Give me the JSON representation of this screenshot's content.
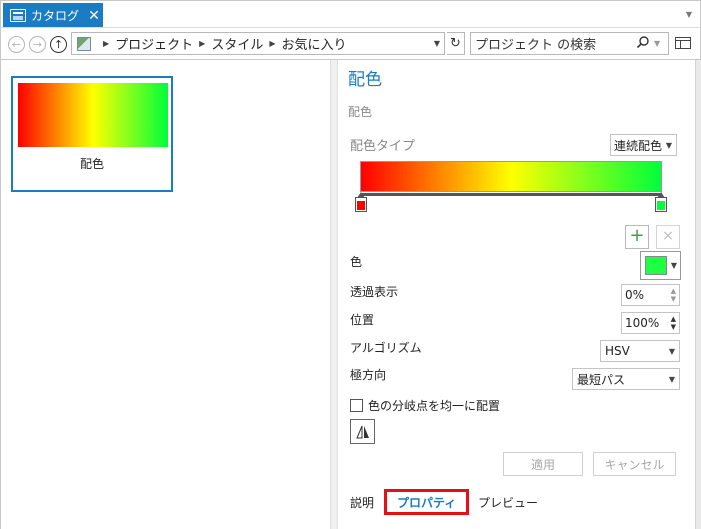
{
  "tab": {
    "title": "カタログ",
    "close": "✕",
    "icon": "catalog-icon"
  },
  "address": {
    "back_icon": "back-arrow-icon",
    "forward_icon": "forward-arrow-icon",
    "up_icon": "up-arrow-icon",
    "path": [
      "プロジェクト",
      "スタイル",
      "お気に入り"
    ],
    "search_placeholder": "プロジェクト の検索"
  },
  "gallery": {
    "items": [
      {
        "label": "配色"
      }
    ]
  },
  "properties": {
    "title": "配色",
    "subtitle": "配色",
    "color_scheme_type_label": "配色タイプ",
    "color_scheme_type_value": "連続配色",
    "ramp_colors": {
      "start": "#ff0000",
      "mid": "#ffff00",
      "end": "#00ff3a"
    },
    "stops": [
      {
        "color": "#ff0000",
        "position_percent": 0
      },
      {
        "color": "#00ff3a",
        "position_percent": 100
      }
    ],
    "add_stop_label": "+",
    "delete_stop_label": "×",
    "color_label": "色",
    "selected_color": "#1eff46",
    "transparency_label": "透過表示",
    "transparency_value": "0%",
    "position_label": "位置",
    "position_value": "100%",
    "algorithm_label": "アルゴリズム",
    "algorithm_value": "HSV",
    "polar_direction_label": "極方向",
    "polar_direction_value": "最短パス",
    "distribute_evenly_label": "色の分岐点を均一に配置",
    "apply_label": "適用",
    "cancel_label": "キャンセル"
  },
  "bottom_tabs": [
    {
      "label": "説明",
      "active": false
    },
    {
      "label": "プロパティ",
      "active": true
    },
    {
      "label": "プレビュー",
      "active": false
    }
  ],
  "colors": {
    "accent": "#1a7cc3",
    "highlight": "#e41016"
  }
}
